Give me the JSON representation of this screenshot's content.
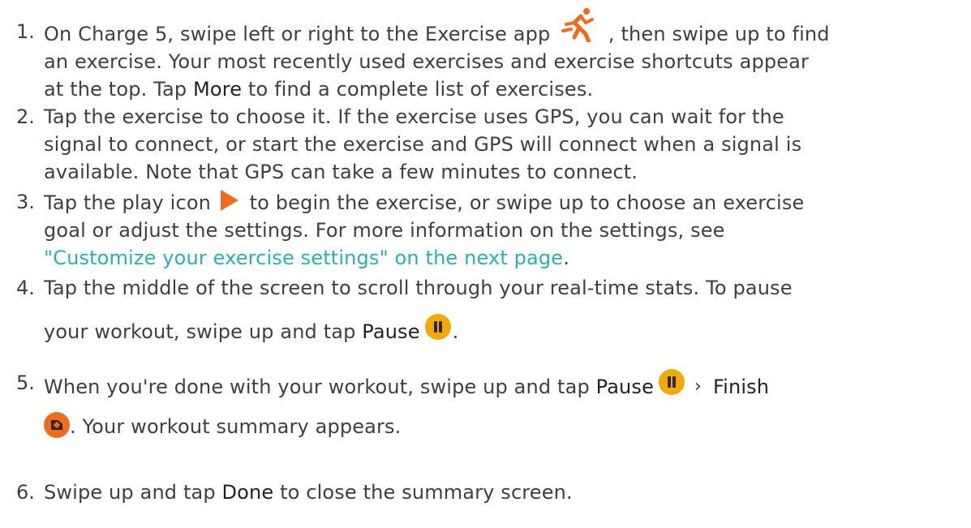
{
  "steps": [
    {
      "number": "1.",
      "line1_before": "On Charge 5, swipe left or right to the Exercise app ",
      "line1_after": " , then swipe up to find",
      "line2": "an exercise. Your most recently used exercises and exercise shortcuts appear",
      "line3_before": "at the top. Tap ",
      "line3_bold": "More",
      "line3_after": " to find a complete list of exercises.",
      "icon": "exercise-runner-icon"
    },
    {
      "number": "2.",
      "line1": "Tap the exercise to choose it. If the exercise uses GPS, you can wait for the",
      "line2": "signal to connect, or start the exercise and GPS will connect when a signal is",
      "line3": "available. Note that GPS can take a few minutes to connect."
    },
    {
      "number": "3.",
      "line1_before": "Tap the play icon ",
      "line1_after": " to begin the exercise, or swipe up to choose an exercise",
      "line2": "goal or adjust the settings. For more information on the settings, see",
      "link_text": "\"Customize your exercise settings\" on the next page",
      "line3_after": ".",
      "icon": "play-icon"
    },
    {
      "number": "4.",
      "line1": "Tap the middle of the screen to scroll through your real-time stats. To pause",
      "line2_before": "your workout, swipe up and tap ",
      "line2_bold": "Pause",
      "line2_after": ".",
      "icon": "pause-icon"
    },
    {
      "number": "5.",
      "line1_before": "When you're done with your workout, swipe up and tap ",
      "line1_bold": "Pause",
      "chevron": "›",
      "line1_bold2": "Finish",
      "line2_after": ". Your workout summary appears.",
      "icons": [
        "pause-icon",
        "chevron-right-icon",
        "finish-icon"
      ]
    },
    {
      "number": "6.",
      "line1_before": "Swipe up and tap ",
      "line1_bold": "Done",
      "line1_after": " to close the summary screen."
    }
  ],
  "colors": {
    "text": "#3f3f3f",
    "link": "#2ab0b0",
    "runner": "#f26b1d",
    "play": "#f26b1d",
    "pause": "#f2a900",
    "finish": "#f26b1d"
  }
}
